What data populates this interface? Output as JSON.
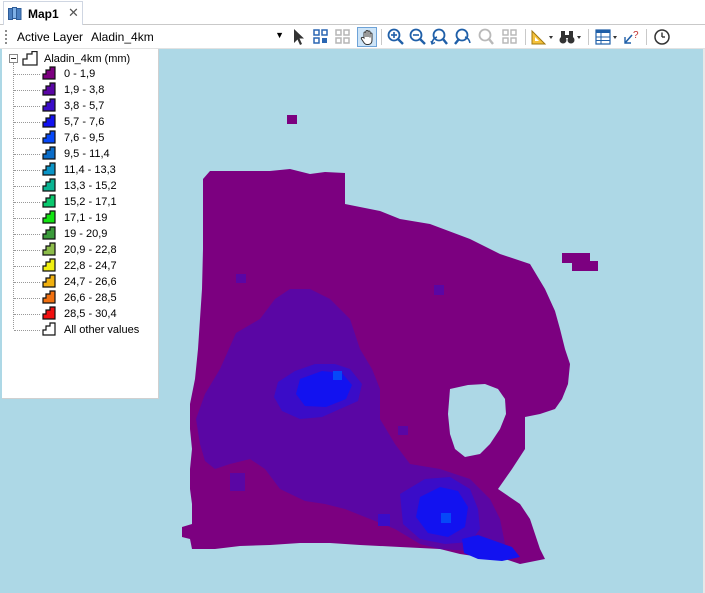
{
  "tab": {
    "title": "Map1",
    "close_icon": "close-icon"
  },
  "toolbar": {
    "active_layer_label": "Active Layer",
    "active_layer_value": "Aladin_4km",
    "tools": [
      "select-pointer-icon",
      "select-features-icon",
      "select-by-area-icon",
      "pan-hand-icon",
      "zoom-in-icon",
      "zoom-out-icon",
      "zoom-previous-icon",
      "zoom-next-icon",
      "zoom-extent-icon",
      "zoom-layer-icon",
      "measure-icon",
      "find-binoculars-icon",
      "attribute-table-icon",
      "identify-icon",
      "time-clock-icon"
    ]
  },
  "legend": {
    "layer_title": "Aladin_4km (mm)",
    "items": [
      {
        "label": "0 - 1,9",
        "color": "#7c0080"
      },
      {
        "label": "1,9 - 3,8",
        "color": "#5a06a4"
      },
      {
        "label": "3,8 - 5,7",
        "color": "#3a0cc8"
      },
      {
        "label": "5,7 - 7,6",
        "color": "#1212f0"
      },
      {
        "label": "7,6 - 9,5",
        "color": "#0648f8"
      },
      {
        "label": "9,5 - 11,4",
        "color": "#0a6cc8"
      },
      {
        "label": "11,4 - 13,3",
        "color": "#0a94c6"
      },
      {
        "label": "13,3 - 15,2",
        "color": "#0ab492"
      },
      {
        "label": "15,2 - 17,1",
        "color": "#0ac86e"
      },
      {
        "label": "17,1 - 19",
        "color": "#12e412"
      },
      {
        "label": "19 - 20,9",
        "color": "#3a9a3a"
      },
      {
        "label": "20,9 - 22,8",
        "color": "#8cbc4a"
      },
      {
        "label": "22,8 - 24,7",
        "color": "#f0f010"
      },
      {
        "label": "24,7 - 26,6",
        "color": "#f0b010"
      },
      {
        "label": "26,6 - 28,5",
        "color": "#f07010"
      },
      {
        "label": "28,5 - 30,4",
        "color": "#f01010"
      },
      {
        "label": "All other values",
        "color": "#ffffff"
      }
    ]
  },
  "map": {
    "background": "#add8e6",
    "base_color": "#7c0080"
  }
}
